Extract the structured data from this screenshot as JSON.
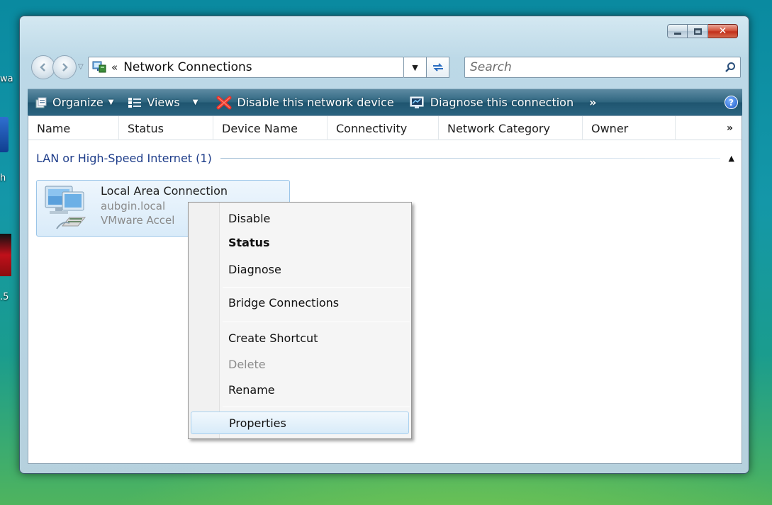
{
  "desktop": {
    "fragments": [
      "wa",
      "h",
      ".5"
    ]
  },
  "window": {
    "caption_buttons": {
      "minimize_icon": "minimize-icon",
      "maximize_icon": "maximize-icon",
      "close_icon": "close-icon",
      "close_glyph": "✕"
    },
    "address_bar": {
      "chevron": "«",
      "path": "Network Connections",
      "dropdown_glyph": "▼"
    },
    "search": {
      "placeholder": "Search"
    },
    "toolbar": {
      "items": [
        {
          "label": "Organize",
          "icon": "organize-icon",
          "caret": "▼"
        },
        {
          "label": "Views",
          "icon": "views-icon",
          "caret": "▼"
        },
        {
          "label": "Disable this network device",
          "icon": "red-x-icon"
        },
        {
          "label": "Diagnose this connection",
          "icon": "diagnose-icon"
        }
      ],
      "overflow": "»",
      "help": "?"
    },
    "columns": [
      "Name",
      "Status",
      "Device Name",
      "Connectivity",
      "Network Category",
      "Owner"
    ],
    "columns_overflow": "»",
    "group": {
      "title": "LAN or High-Speed Internet (1)",
      "collapse_glyph": "▲"
    },
    "connection": {
      "name": "Local Area Connection",
      "line1": "aubgin.local",
      "line2": "VMware Accel"
    }
  },
  "context_menu": {
    "items": [
      "Disable",
      "Status",
      "Diagnose",
      "Bridge Connections",
      "Create Shortcut",
      "Delete",
      "Rename",
      "Properties"
    ],
    "default_item": "Status",
    "disabled_item": "Delete",
    "highlighted_item": "Properties"
  },
  "colors": {
    "toolbar": "#2f6680",
    "group_title": "#1e3d8a",
    "menu_highlight": "#d8ebf9",
    "close_button": "#c2301a"
  }
}
